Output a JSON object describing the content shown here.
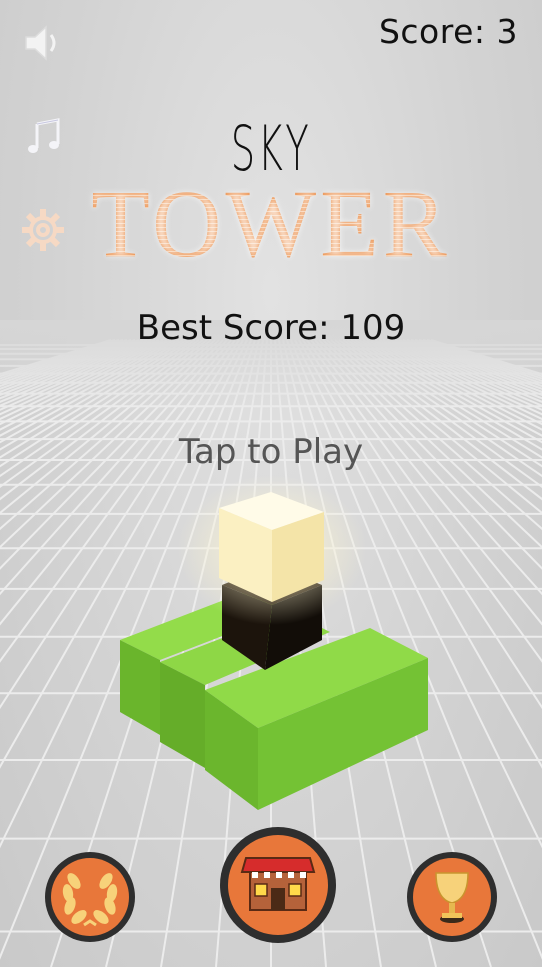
{
  "hud": {
    "score_label": "Score: 3",
    "best_score_label": "Best Score: 109"
  },
  "title": {
    "line1": "SKY",
    "line2": "TOWER"
  },
  "prompt": "Tap to Play",
  "side_buttons": [
    {
      "name": "sound-button",
      "icon": "speaker-icon"
    },
    {
      "name": "music-button",
      "icon": "music-note-icon"
    },
    {
      "name": "settings-button",
      "icon": "gear-icon"
    }
  ],
  "bottom_buttons": [
    {
      "name": "achievements-button",
      "icon": "laurel-wreath-icon"
    },
    {
      "name": "shop-button",
      "icon": "shop-icon"
    },
    {
      "name": "leaderboard-button",
      "icon": "trophy-icon"
    }
  ],
  "colors": {
    "title_orange": "#ea8c46",
    "button_orange": "#e8773a",
    "platform_green": "#7ccb3a",
    "glow_block": "#fff3c8",
    "dark_block": "#1c140c",
    "background": "#d6d6d6"
  }
}
